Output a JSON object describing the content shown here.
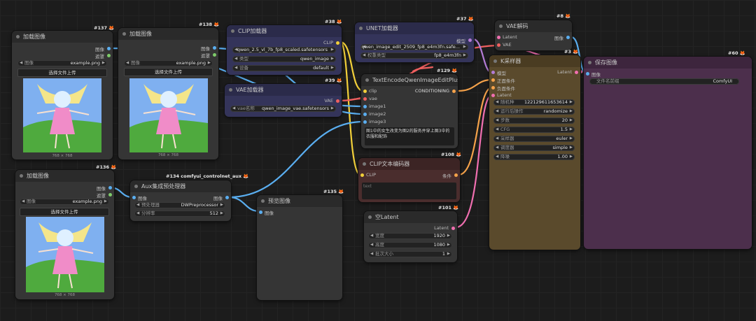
{
  "colors": {
    "clip": "#f2d03a",
    "vae": "#f06060",
    "image": "#5aaef0",
    "model": "#b47cd6",
    "latent": "#f06fb0",
    "conditioning": "#f5a24a",
    "control": "#3ea0d0"
  },
  "nodes": {
    "load1": {
      "id": "#137",
      "title": "加载图像",
      "out_image": "图像",
      "out_mask": "遮罩",
      "image_label": "图像",
      "image_value": "example.png",
      "upload": "选择文件上传",
      "caption": "768 × 768"
    },
    "load2": {
      "id": "#138",
      "title": "加载图像",
      "out_image": "图像",
      "out_mask": "遮罩",
      "image_label": "图像",
      "image_value": "example.png",
      "upload": "选择文件上传",
      "caption": "768 × 768"
    },
    "load3": {
      "id": "#136",
      "title": "加载图像",
      "out_image": "图像",
      "out_mask": "遮罩",
      "image_label": "图像",
      "image_value": "example.png",
      "upload": "选择文件上传",
      "caption": "768 × 768"
    },
    "clip_loader": {
      "id": "#38",
      "title": "CLIP加载器",
      "out": "CLIP",
      "w1_value": "qwen_2.5_vl_7b_fp8_scaled.safetensors",
      "w2_label": "类型",
      "w2_value": "qwen_image",
      "w3_label": "设备",
      "w3_value": "default"
    },
    "vae_loader": {
      "id": "#39",
      "title": "VAE加载器",
      "out": "VAE",
      "w1_label": "vae名称",
      "w1_value": "qwen_image_vae.safetensors"
    },
    "unet": {
      "id": "#37",
      "title": "UNET加载器",
      "out": "模型",
      "w1_value": "qwen_image_edit_2509_fp8_e4m3fn.safe...",
      "w2_label": "权重类型",
      "w2_value": "fp8_e4m3fn"
    },
    "vae_decode": {
      "id": "#8",
      "title": "VAE解码",
      "in1": "Latent",
      "in2": "VAE",
      "out": "图像"
    },
    "save": {
      "id": "#60",
      "title": "保存图像",
      "in": "图像",
      "w1_label": "文件名前缀",
      "w1_value": "ComfyUI"
    },
    "ksampler": {
      "id": "#3",
      "title": "K采样器",
      "in_model": "模型",
      "in_pos": "正面条件",
      "in_neg": "负面条件",
      "in_latent": "Latent",
      "out": "Latent",
      "widgets": [
        {
          "label": "随机种",
          "value": "122129611653614"
        },
        {
          "label": "运行后操作",
          "value": "randomize"
        },
        {
          "label": "步数",
          "value": "20"
        },
        {
          "label": "CFG",
          "value": "1.5"
        },
        {
          "label": "采样器",
          "value": "euler"
        },
        {
          "label": "调度器",
          "value": "simple"
        },
        {
          "label": "降噪",
          "value": "1.00"
        }
      ]
    },
    "textenc": {
      "id": "#129",
      "title": "TextEncodeQwenImageEditPlus",
      "in_clip": "clip",
      "in_vae": "vae",
      "in_img1": "image1",
      "in_img2": "image2",
      "in_img3": "image3",
      "out": "CONDITIONING",
      "text": "图1中的女生改变为图2的服务并穿上图3中的衣服和配饰"
    },
    "clipenc": {
      "id": "#108",
      "title": "CLIP文本编码器",
      "in": "CLIP",
      "out": "条件",
      "placeholder": "text"
    },
    "empty_latent": {
      "id": "#101",
      "title": "空Latent",
      "out": "Latent",
      "w1_label": "宽度",
      "w1_value": "1920",
      "w2_label": "高度",
      "w2_value": "1080",
      "w3_label": "批次大小",
      "w3_value": "1"
    },
    "aux": {
      "id": "#134 comfyui_controlnet_aux",
      "title": "Aux集成预处理器",
      "in": "图像",
      "out": "图像",
      "w1_label": "预处理器",
      "w1_value": "DWPreprocessor",
      "w2_label": "分辨率",
      "w2_value": "512"
    },
    "preview": {
      "id": "#135",
      "title": "预览图像",
      "in": "图像"
    }
  }
}
